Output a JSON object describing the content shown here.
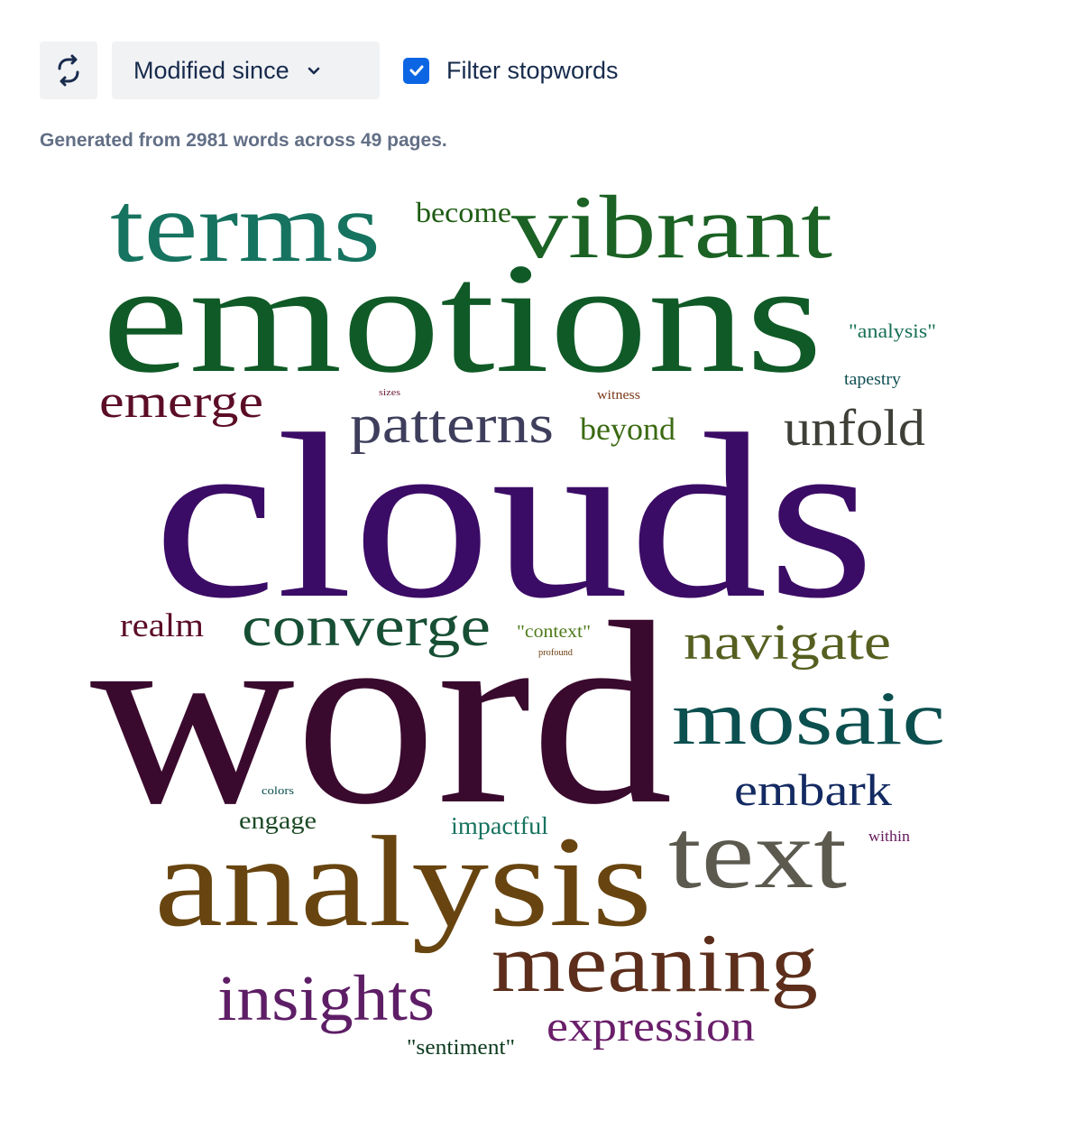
{
  "toolbar": {
    "refresh_icon": "refresh-icon",
    "dropdown_label": "Modified since",
    "dropdown_icon": "chevron-down-icon",
    "filter_label": "Filter stopwords",
    "filter_checked": true
  },
  "summary": "Generated from 2981 words across 49 pages.",
  "words": [
    {
      "text": "terms",
      "color": "#16735f"
    },
    {
      "text": "become",
      "color": "#1e5c13"
    },
    {
      "text": "vibrant",
      "color": "#1b6224"
    },
    {
      "text": "emotions",
      "color": "#105a27"
    },
    {
      "text": "\"analysis\"",
      "color": "#177055"
    },
    {
      "text": "tapestry",
      "color": "#0f4e53"
    },
    {
      "text": "emerge",
      "color": "#5c0d26"
    },
    {
      "text": "sizes",
      "color": "#6b1a3a"
    },
    {
      "text": "witness",
      "color": "#7b3a1a"
    },
    {
      "text": "patterns",
      "color": "#3e3e5c"
    },
    {
      "text": "beyond",
      "color": "#3b6a12"
    },
    {
      "text": "unfold",
      "color": "#3f3f38"
    },
    {
      "text": "clouds",
      "color": "#3b0c66"
    },
    {
      "text": "realm",
      "color": "#5c0d26"
    },
    {
      "text": "converge",
      "color": "#174f34"
    },
    {
      "text": "\"context\"",
      "color": "#4f7a1a"
    },
    {
      "text": "profound",
      "color": "#6b3b0c"
    },
    {
      "text": "navigate",
      "color": "#565f20"
    },
    {
      "text": "word",
      "color": "#3a0a2e"
    },
    {
      "text": "mosaic",
      "color": "#0c4f4f"
    },
    {
      "text": "colors",
      "color": "#0c4f4f"
    },
    {
      "text": "embark",
      "color": "#132a62"
    },
    {
      "text": "engage",
      "color": "#1b4a26"
    },
    {
      "text": "impactful",
      "color": "#16735f"
    },
    {
      "text": "within",
      "color": "#661a5c"
    },
    {
      "text": "analysis",
      "color": "#684510"
    },
    {
      "text": "text",
      "color": "#5c5a4f"
    },
    {
      "text": "meaning",
      "color": "#5c2e1b"
    },
    {
      "text": "insights",
      "color": "#5e1e66"
    },
    {
      "text": "expression",
      "color": "#6a1e6a"
    },
    {
      "text": "\"sentiment\"",
      "color": "#0c3a1e"
    }
  ]
}
